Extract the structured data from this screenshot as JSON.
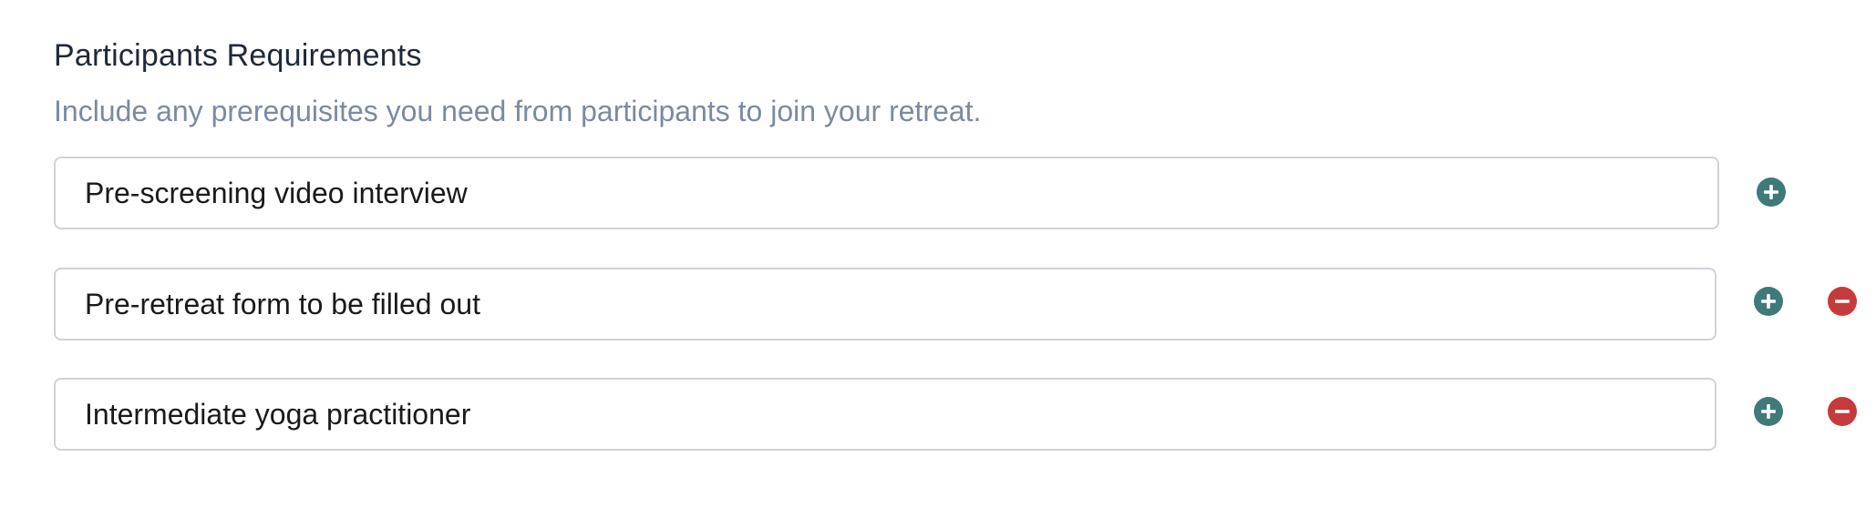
{
  "section": {
    "title": "Participants Requirements",
    "subtitle": "Include any prerequisites you need from participants to join your retreat."
  },
  "requirements": [
    {
      "value": "Pre-screening video interview",
      "add_icon": "plus-circle-icon"
    },
    {
      "value": "Pre-retreat form to be filled out",
      "add_icon": "plus-circle-icon",
      "remove_icon": "minus-circle-icon"
    },
    {
      "value": "Intermediate yoga practitioner",
      "add_icon": "plus-circle-icon",
      "remove_icon": "minus-circle-icon"
    }
  ],
  "colors": {
    "title": "#1f2937",
    "subtitle": "#7b8aa3",
    "add_button": "#3f7a79",
    "remove_button": "#c53b3b",
    "field_border": "#cfd3d8"
  }
}
